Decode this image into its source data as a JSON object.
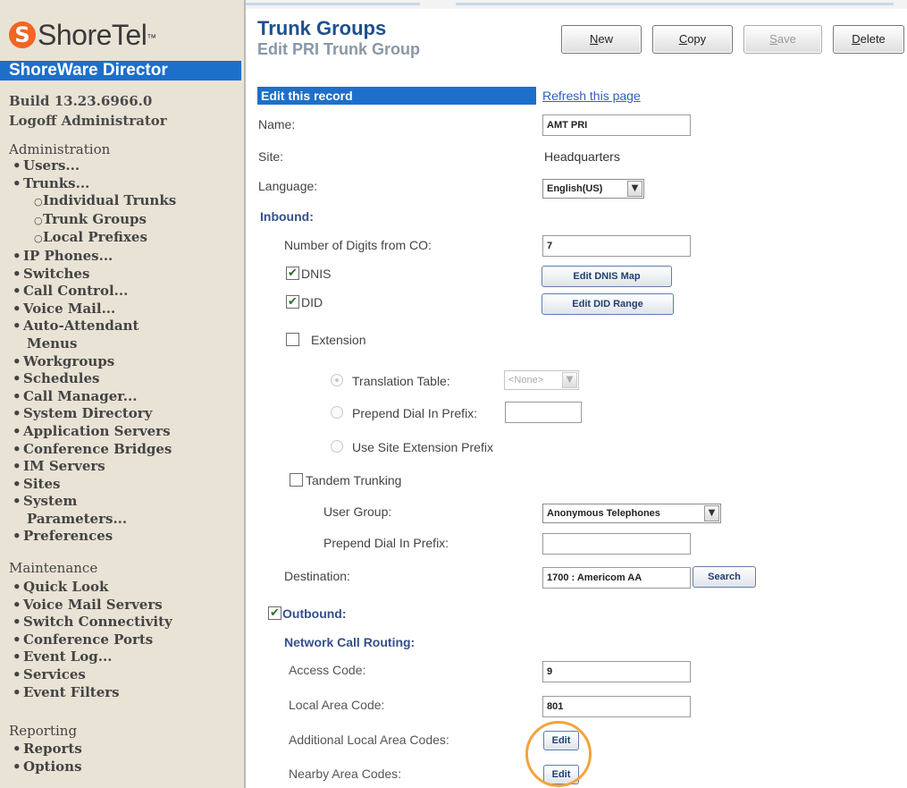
{
  "sidebar": {
    "logo": {
      "text": "ShoreTel",
      "trademark": "™",
      "icon": "shoretel-logo-icon",
      "brand_color": "#f26522"
    },
    "app_title": "ShoreWare Director",
    "build": "Build 13.23.6966.0",
    "logoff": "Logoff Administrator",
    "administration": {
      "title": "Administration",
      "items": [
        {
          "label": "Users...",
          "level": 1
        },
        {
          "label": "Trunks...",
          "level": 1
        },
        {
          "label": "Individual Trunks",
          "level": 2
        },
        {
          "label": "Trunk Groups",
          "level": 2
        },
        {
          "label": "Local Prefixes",
          "level": 2
        },
        {
          "label": "IP Phones...",
          "level": 1
        },
        {
          "label": "Switches",
          "level": 1
        },
        {
          "label": "Call Control...",
          "level": 1
        },
        {
          "label": "Voice Mail...",
          "level": 1
        },
        {
          "label": "Auto-Attendant",
          "level": 1
        },
        {
          "label": "Menus",
          "level": 0
        },
        {
          "label": "Workgroups",
          "level": 1
        },
        {
          "label": "Schedules",
          "level": 1
        },
        {
          "label": "Call Manager...",
          "level": 1
        },
        {
          "label": "System Directory",
          "level": 1
        },
        {
          "label": "Application Servers",
          "level": 1
        },
        {
          "label": "Conference Bridges",
          "level": 1
        },
        {
          "label": "IM Servers",
          "level": 1
        },
        {
          "label": "Sites",
          "level": 1
        },
        {
          "label": "System",
          "level": 1
        },
        {
          "label": "Parameters...",
          "level": 0
        },
        {
          "label": "Preferences",
          "level": 1
        }
      ]
    },
    "maintenance": {
      "title": "Maintenance",
      "items": [
        {
          "label": "Quick Look",
          "level": 1
        },
        {
          "label": "Voice Mail Servers",
          "level": 1
        },
        {
          "label": "Switch Connectivity",
          "level": 1
        },
        {
          "label": "Conference Ports",
          "level": 1
        },
        {
          "label": "Event Log...",
          "level": 1
        },
        {
          "label": "Services",
          "level": 1
        },
        {
          "label": "Event Filters",
          "level": 1
        }
      ]
    },
    "reporting": {
      "title": "Reporting",
      "items": [
        {
          "label": "Reports",
          "level": 1
        },
        {
          "label": "Options",
          "level": 1
        }
      ]
    }
  },
  "header": {
    "title": "Trunk Groups",
    "subtitle": "Edit PRI Trunk Group",
    "buttons": {
      "new": {
        "first": "N",
        "rest": "ew"
      },
      "copy": {
        "first": "C",
        "rest": "opy"
      },
      "save": {
        "first": "S",
        "rest": "ave"
      },
      "delete": {
        "first": "D",
        "rest": "elete"
      }
    }
  },
  "form": {
    "section_header": "Edit this record",
    "refresh_link": "Refresh this page",
    "name_label": "Name:",
    "name_value": "AMT PRI",
    "site_label": "Site:",
    "site_value": "Headquarters",
    "language_label": "Language:",
    "language_value": "English(US)",
    "inbound_label": "Inbound:",
    "digits_label": "Number of Digits from CO:",
    "digits_value": "7",
    "dnis_label": "DNIS",
    "dnis_checked": "✔",
    "dnis_button": "Edit DNIS Map",
    "did_label": "DID",
    "did_checked": "✔",
    "did_button": "Edit DID Range",
    "extension_label": "Extension",
    "translation_label": "Translation Table:",
    "translation_value": "<None>",
    "prepend_prefix_label": "Prepend Dial In Prefix:",
    "site_ext_prefix_label": "Use Site Extension Prefix",
    "tandem_label": "Tandem Trunking",
    "user_group_label": "User Group:",
    "user_group_value": "Anonymous Telephones",
    "tandem_prepend_label": "Prepend Dial In Prefix:",
    "destination_label": "Destination:",
    "destination_value": "1700 : Americom AA",
    "search_button": "Search",
    "outbound_label": "Outbound:",
    "outbound_checked": "✔",
    "ncr_label": "Network Call Routing:",
    "access_code_label": "Access Code:",
    "access_code_value": "9",
    "local_area_label": "Local Area Code:",
    "local_area_value": "801",
    "additional_codes_label": "Additional Local Area Codes:",
    "additional_edit": "Edit",
    "nearby_codes_label": "Nearby Area Codes:",
    "nearby_edit": "Edit",
    "dropdown_arrow": "▼"
  },
  "colors": {
    "accent": "#1e6fc9",
    "sidebar_bg": "#e9e3d6",
    "title": "#1e4f8f",
    "highlight": "#f3a33d"
  }
}
